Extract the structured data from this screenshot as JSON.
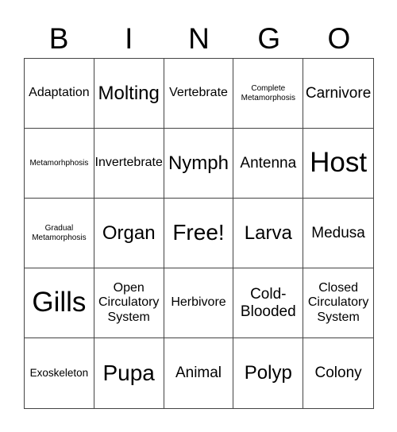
{
  "header": {
    "letters": [
      "B",
      "I",
      "N",
      "G",
      "O"
    ]
  },
  "cells": [
    "Adaptation",
    "Molting",
    "Vertebrate",
    "Complete Metamorphosis",
    "Carnivore",
    "Metamorhphosis",
    "Invertebrate",
    "Nymph",
    "Antenna",
    "Host",
    "Gradual Metamorphosis",
    "Organ",
    "Free!",
    "Larva",
    "Medusa",
    "Gills",
    "Open Circulatory System",
    "Herbivore",
    "Cold-Blooded",
    "Closed Circulatory System",
    "Exoskeleton",
    "Pupa",
    "Animal",
    "Polyp",
    "Colony"
  ]
}
